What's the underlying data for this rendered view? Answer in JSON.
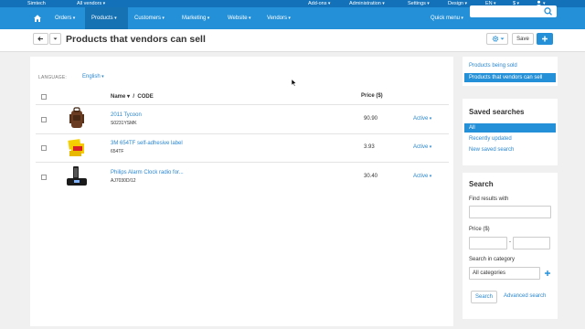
{
  "topbar": {
    "brand": "Simtech",
    "vendor": "All vendors",
    "menu": [
      "Add-ons",
      "Administration",
      "Settings",
      "Design",
      "EN",
      "$"
    ]
  },
  "nav": {
    "items": [
      "Orders",
      "Products",
      "Customers",
      "Marketing",
      "Website",
      "Vendors"
    ],
    "active": "Products",
    "quick_menu": "Quick menu",
    "search_placeholder": ""
  },
  "header": {
    "title": "Products that vendors can sell",
    "save_label": "Save"
  },
  "main": {
    "language_label": "LANGUAGE:",
    "language_value": "English",
    "columns": {
      "name": "Name",
      "sep": "/",
      "code": "CODE",
      "price": "Price ($)"
    },
    "products": [
      {
        "name": "2011 Tycoon",
        "code": "S0231YSMK",
        "price": "90.90",
        "status": "Active"
      },
      {
        "name": "3M 654TF self-adhesive label",
        "code": "654TF",
        "price": "3.93",
        "status": "Active"
      },
      {
        "name": "Philips Alarm Clock radio for...",
        "code": "AJ7030D/12",
        "price": "30.40",
        "status": "Active"
      }
    ]
  },
  "sidebar": {
    "views": [
      "Products being sold",
      "Products that vendors can sell"
    ],
    "saved_title": "Saved searches",
    "saved": [
      "All",
      "Recently updated",
      "New saved search"
    ],
    "search_title": "Search",
    "find_label": "Find results with",
    "price_label": "Price ($)",
    "price_dash": "-",
    "category_label": "Search in category",
    "category_value": "All categories",
    "search_button": "Search",
    "advanced_link": "Advanced search"
  },
  "colors": {
    "primary": "#2390d8",
    "topbar": "#1271b8",
    "link": "#2a87d0"
  }
}
